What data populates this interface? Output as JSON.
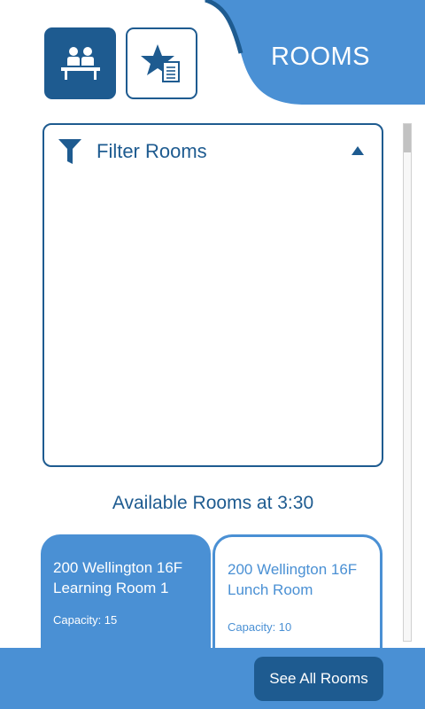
{
  "header": {
    "title": "ROOMS",
    "nav_buttons": [
      {
        "icon": "meeting-room-icon",
        "active": true
      },
      {
        "icon": "favorites-list-icon",
        "active": false
      }
    ]
  },
  "filter": {
    "label": "Filter Rooms",
    "icon": "funnel-icon",
    "toggle_icon": "collapse-arrow-up-icon",
    "expanded": true
  },
  "available": {
    "heading": "Available Rooms at 3:30"
  },
  "rooms": [
    {
      "name_line1": "200 Wellington 16F",
      "name_line2": "Learning Room 1",
      "capacity": "Capacity: 15",
      "selected": true
    },
    {
      "name_line1": "200 Wellington 16F",
      "name_line2": "Lunch Room",
      "capacity": "Capacity: 10",
      "selected": false
    }
  ],
  "footer": {
    "see_all_label": "See All Rooms"
  },
  "colors": {
    "primary_dark": "#1e5b90",
    "primary_light": "#4a90d4",
    "background": "#ffffff"
  }
}
